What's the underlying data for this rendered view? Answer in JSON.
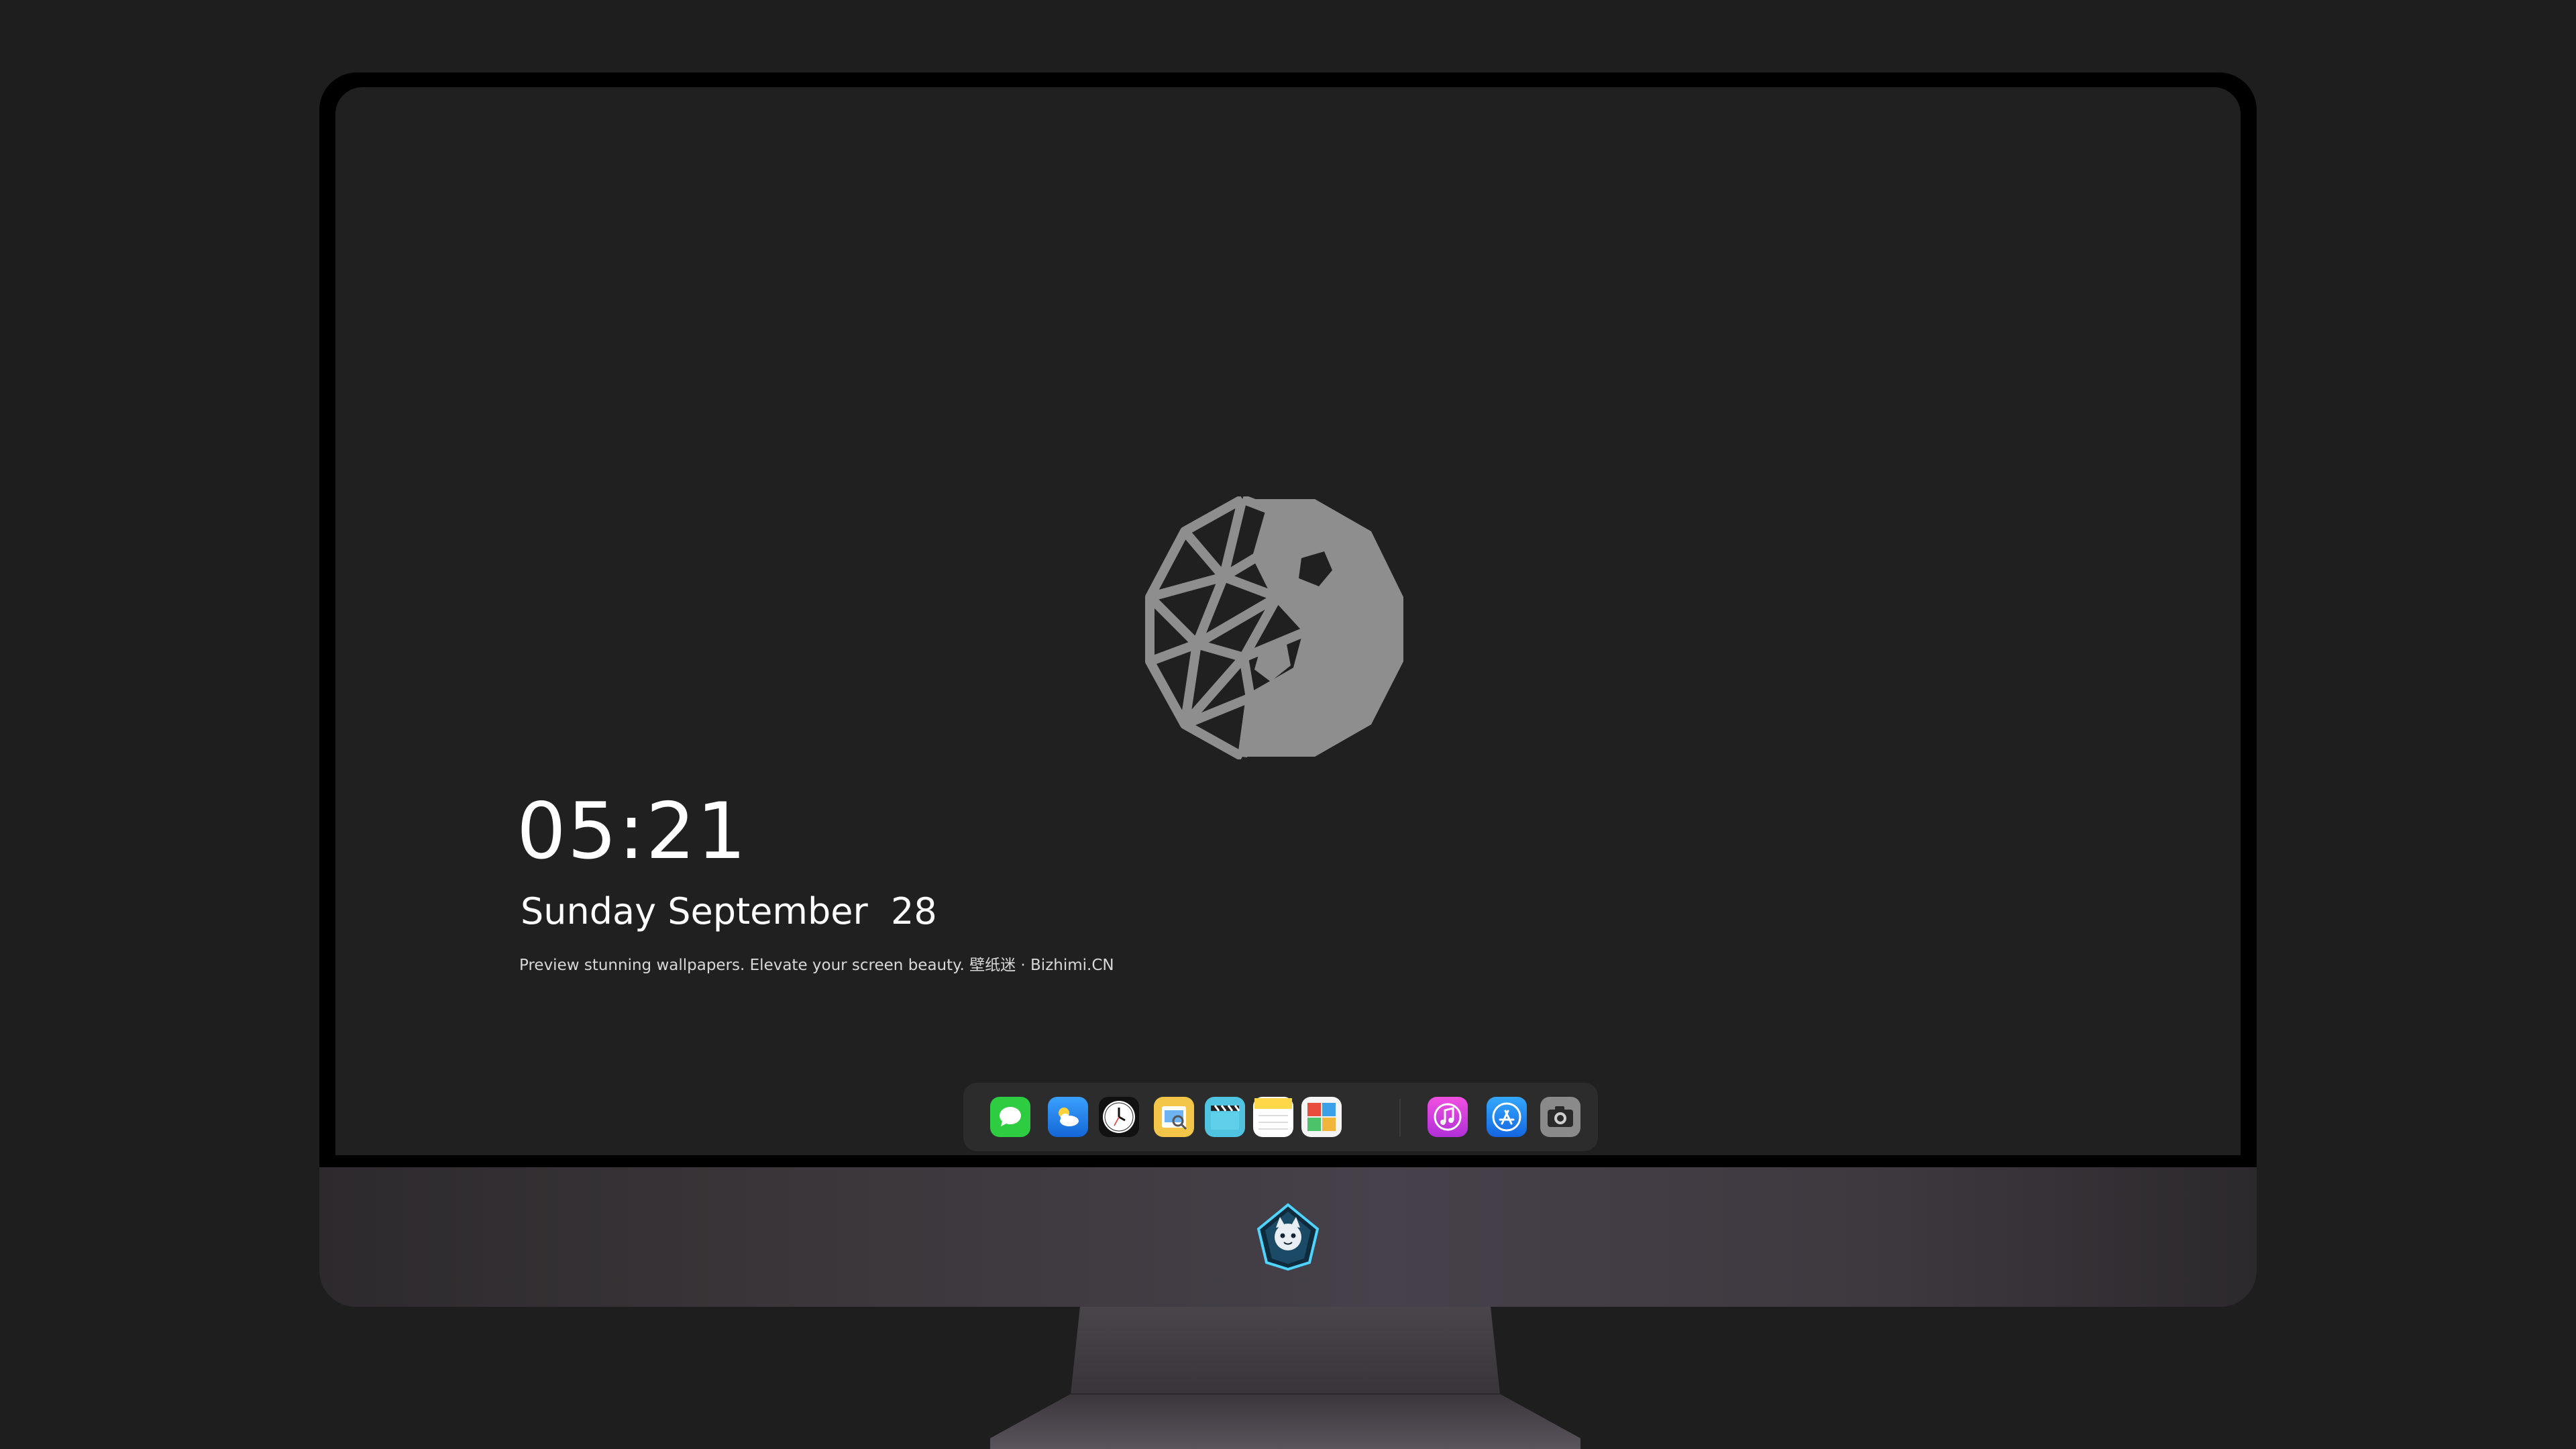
{
  "lock_screen": {
    "time": "05:21",
    "date": "Sunday September  28",
    "tagline": "Preview stunning wallpapers. Elevate your screen beauty. 壁纸迷 · Bizhimi.CN"
  },
  "wallpaper": {
    "logo_icon": "polygon-yin-yang-icon",
    "logo_color": "#8e8e8e",
    "background_color": "#202020"
  },
  "dock": {
    "apps": [
      {
        "name": "Messages",
        "icon": "messages-icon",
        "color": "#2ecc40"
      },
      {
        "name": "Weather",
        "icon": "weather-icon",
        "color": "#1e90ff"
      },
      {
        "name": "Clock",
        "icon": "clock-icon",
        "color": "#111111"
      },
      {
        "name": "Preview",
        "icon": "preview-icon",
        "color": "#f3c64a"
      },
      {
        "name": "Clips",
        "icon": "clapperboard-icon",
        "color": "#4fc3e0"
      },
      {
        "name": "Notes",
        "icon": "notes-icon",
        "color": "#ffd84a"
      },
      {
        "name": "Photo Booth",
        "icon": "photo-grid-icon",
        "color": "#e94b3c"
      },
      {
        "name": "iTunes",
        "icon": "music-note-icon",
        "color": "#d946ef"
      },
      {
        "name": "App Store",
        "icon": "app-store-icon",
        "color": "#1b8af0"
      },
      {
        "name": "Camera",
        "icon": "camera-icon",
        "color": "#8a8a8a"
      }
    ]
  },
  "monitor": {
    "chin_badge_icon": "cat-mascot-badge-icon"
  }
}
